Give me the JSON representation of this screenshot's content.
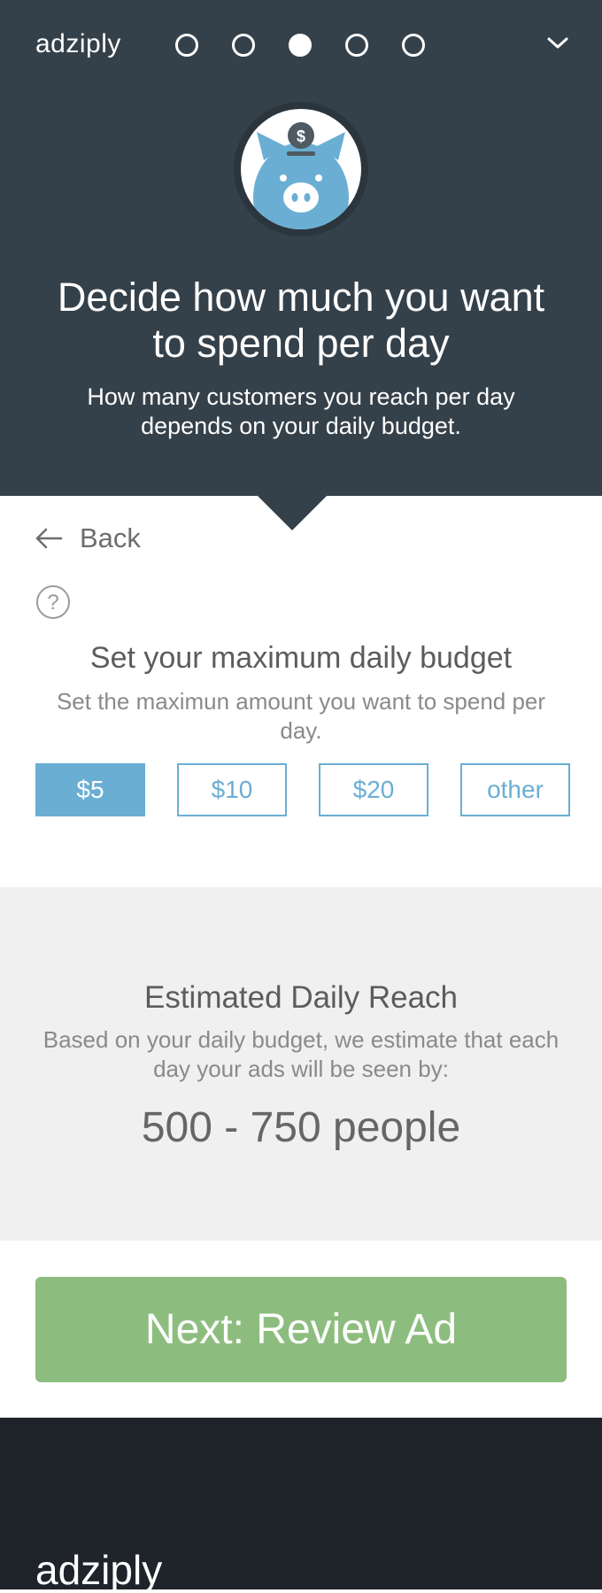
{
  "header": {
    "brand": "adziply",
    "progress": {
      "total_steps": 5,
      "current_step": 3
    },
    "menu_icon": "chevron-down-icon"
  },
  "hero": {
    "icon": "piggy-bank-icon",
    "title_line1": "Decide how much you want",
    "title_line2": "to spend per day",
    "subtitle_line1": "How many customers you reach per day",
    "subtitle_line2": "depends on your daily budget."
  },
  "form": {
    "back_label": "Back",
    "help_icon": "question-circle-icon",
    "title": "Set your maximum daily budget",
    "subtitle_line1": "Set the maximun amount you want to spend per",
    "subtitle_line2": "day.",
    "options": [
      "$5",
      "$10",
      "$20",
      "other"
    ],
    "selected_option": "$5"
  },
  "reach": {
    "title": "Estimated Daily Reach",
    "subtitle_line1": "Based on your daily budget, we estimate that each",
    "subtitle_line2": "day your ads will be seen by:",
    "value": "500 - 750 people"
  },
  "actions": {
    "next_label": "Next: Review Ad"
  },
  "footer": {
    "brand": "adziply"
  },
  "colors": {
    "header_bg": "#35414a",
    "accent_blue": "#6aaed3",
    "next_green": "#8dbd7e",
    "reach_bg": "#f0f0f0",
    "footer_bg": "#1f242b"
  }
}
